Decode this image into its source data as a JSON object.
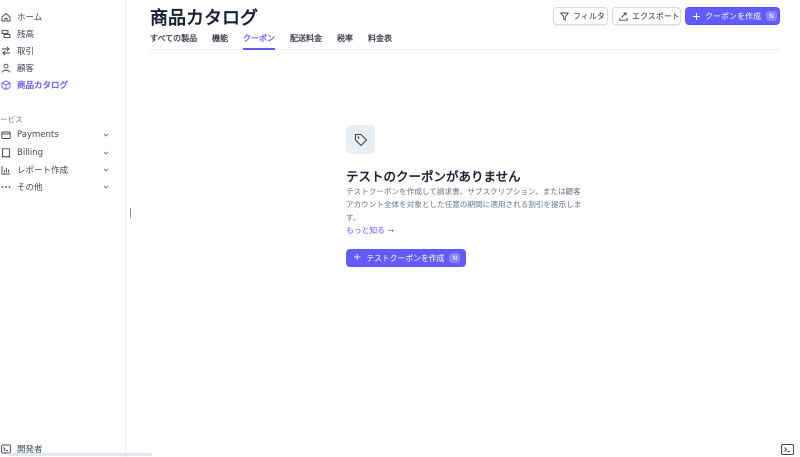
{
  "sidebar": {
    "items": [
      {
        "label": "ホーム",
        "icon": "home-icon"
      },
      {
        "label": "残高",
        "icon": "balance-icon"
      },
      {
        "label": "取引",
        "icon": "transactions-icon"
      },
      {
        "label": "顧客",
        "icon": "customer-icon"
      },
      {
        "label": "商品カタログ",
        "icon": "product-icon",
        "active": true
      }
    ],
    "section_label": "ービス",
    "services": [
      {
        "label": "Payments",
        "icon": "payments-icon"
      },
      {
        "label": "Billing",
        "icon": "billing-icon"
      },
      {
        "label": "レポート作成",
        "icon": "reports-icon"
      },
      {
        "label": "その他",
        "icon": "more-icon"
      }
    ],
    "developer_label": "開発者"
  },
  "header": {
    "title": "商品カタログ",
    "filter_label": "フィルタ",
    "export_label": "エクスポート",
    "create_label": "クーポンを作成",
    "create_shortcut": "N"
  },
  "tabs": [
    {
      "label": "すべての製品"
    },
    {
      "label": "機能"
    },
    {
      "label": "クーポン",
      "active": true
    },
    {
      "label": "配送料金"
    },
    {
      "label": "税率"
    },
    {
      "label": "料金表"
    }
  ],
  "empty_state": {
    "title": "テストのクーポンがありません",
    "description": "テストクーポンを作成して請求書、サブスクリプション、または顧客アカウント全体を対象とした任意の期間に適用される割引を提示します。",
    "learn_more": "もっと知る →",
    "button_label": "テストクーポンを作成",
    "button_shortcut": "N"
  },
  "colors": {
    "accent": "#635bff",
    "text": "#1a1f36",
    "muted": "#687385",
    "border": "#ebeef1"
  }
}
